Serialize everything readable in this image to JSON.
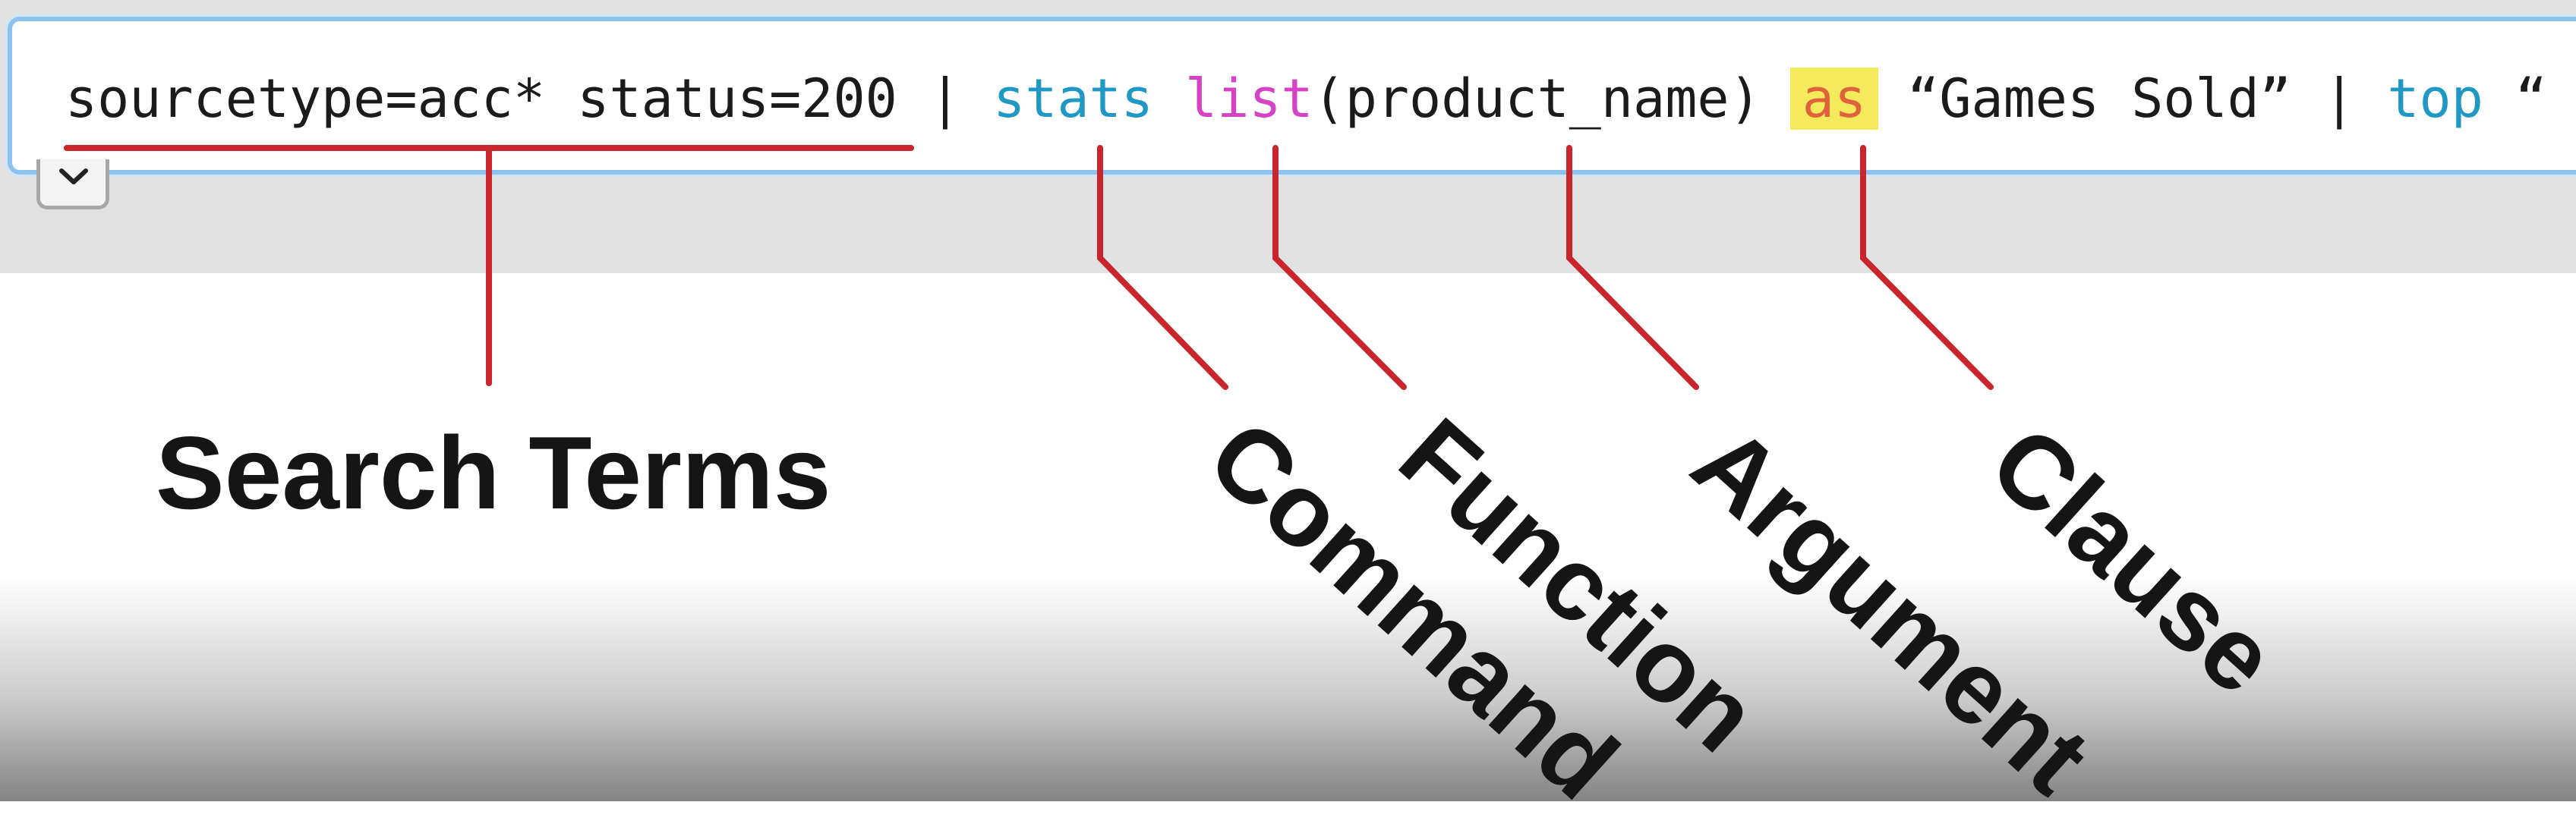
{
  "search_bar": {
    "query_tokens": {
      "search_terms": "sourcetype=acc* status=200",
      "pipe_1": " | ",
      "command": "stats",
      "space_1": " ",
      "function": "list",
      "argument": "(product_name)",
      "space_2": " ",
      "clause": "as",
      "quoted_name": " “Games Sold”",
      "pipe_2": " | ",
      "command_2": "top",
      "trailing": " “"
    },
    "expand_icon": "chevron-down-icon"
  },
  "annotations": {
    "search_terms": "Search Terms",
    "command": "Command",
    "function": "Function",
    "argument": "Argument",
    "clause": "Clause"
  },
  "colors": {
    "command": "#1f98c6",
    "function": "#d642c6",
    "clause_text": "#e0623a",
    "clause_highlight": "#f5ea5c",
    "callout_line": "#c8252c",
    "search_border": "#8cc3ee"
  }
}
